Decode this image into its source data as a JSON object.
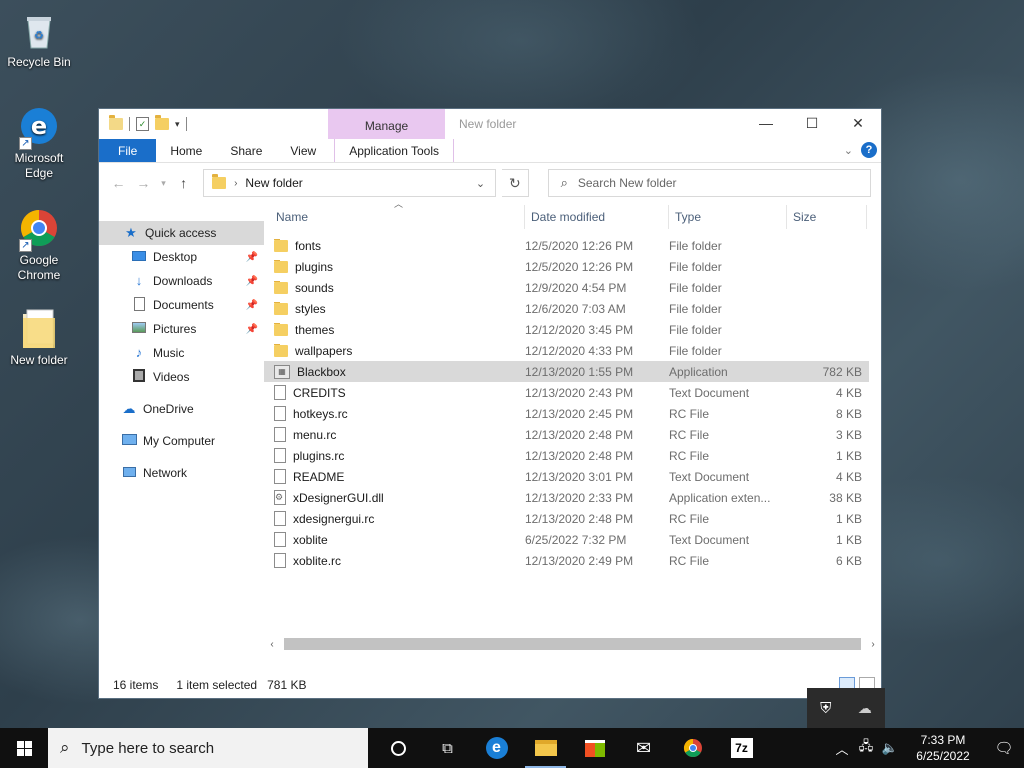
{
  "desktop": {
    "icons": [
      {
        "label": "Recycle Bin",
        "icon": "recycle-bin-icon"
      },
      {
        "label": "Microsoft Edge",
        "icon": "edge-icon"
      },
      {
        "label": "Google Chrome",
        "icon": "chrome-icon"
      },
      {
        "label": "New folder",
        "icon": "folder-icon"
      }
    ]
  },
  "window": {
    "title": "New folder",
    "manage_tab": "Manage",
    "ribbon_tabs": [
      "File",
      "Home",
      "Share",
      "View",
      "Application Tools"
    ],
    "address": "New folder",
    "search_placeholder": "Search New folder",
    "nav_pane": {
      "quick_access": "Quick access",
      "pinned": [
        "Desktop",
        "Downloads",
        "Documents",
        "Pictures"
      ],
      "unpinned": [
        "Music",
        "Videos"
      ],
      "onedrive": "OneDrive",
      "my_computer": "My Computer",
      "network": "Network"
    },
    "columns": [
      "Name",
      "Date modified",
      "Type",
      "Size"
    ],
    "files": [
      {
        "name": "fonts",
        "date": "12/5/2020 12:26 PM",
        "type": "File folder",
        "size": "",
        "kind": "folder"
      },
      {
        "name": "plugins",
        "date": "12/5/2020 12:26 PM",
        "type": "File folder",
        "size": "",
        "kind": "folder"
      },
      {
        "name": "sounds",
        "date": "12/9/2020 4:54 PM",
        "type": "File folder",
        "size": "",
        "kind": "folder"
      },
      {
        "name": "styles",
        "date": "12/6/2020 7:03 AM",
        "type": "File folder",
        "size": "",
        "kind": "folder"
      },
      {
        "name": "themes",
        "date": "12/12/2020 3:45 PM",
        "type": "File folder",
        "size": "",
        "kind": "folder"
      },
      {
        "name": "wallpapers",
        "date": "12/12/2020 4:33 PM",
        "type": "File folder",
        "size": "",
        "kind": "folder"
      },
      {
        "name": "Blackbox",
        "date": "12/13/2020 1:55 PM",
        "type": "Application",
        "size": "782 KB",
        "kind": "app",
        "selected": true
      },
      {
        "name": "CREDITS",
        "date": "12/13/2020 2:43 PM",
        "type": "Text Document",
        "size": "4 KB",
        "kind": "file"
      },
      {
        "name": "hotkeys.rc",
        "date": "12/13/2020 2:45 PM",
        "type": "RC File",
        "size": "8 KB",
        "kind": "file"
      },
      {
        "name": "menu.rc",
        "date": "12/13/2020 2:48 PM",
        "type": "RC File",
        "size": "3 KB",
        "kind": "file"
      },
      {
        "name": "plugins.rc",
        "date": "12/13/2020 2:48 PM",
        "type": "RC File",
        "size": "1 KB",
        "kind": "file"
      },
      {
        "name": "README",
        "date": "12/13/2020 3:01 PM",
        "type": "Text Document",
        "size": "4 KB",
        "kind": "file"
      },
      {
        "name": "xDesignerGUI.dll",
        "date": "12/13/2020 2:33 PM",
        "type": "Application exten...",
        "size": "38 KB",
        "kind": "dll"
      },
      {
        "name": "xdesignergui.rc",
        "date": "12/13/2020 2:48 PM",
        "type": "RC File",
        "size": "1 KB",
        "kind": "file"
      },
      {
        "name": "xoblite",
        "date": "6/25/2022 7:32 PM",
        "type": "Text Document",
        "size": "1 KB",
        "kind": "file"
      },
      {
        "name": "xoblite.rc",
        "date": "12/13/2020 2:49 PM",
        "type": "RC File",
        "size": "6 KB",
        "kind": "file"
      }
    ],
    "status": {
      "item_count": "16 items",
      "selection": "1 item selected",
      "selection_size": "781 KB"
    }
  },
  "taskbar": {
    "search_placeholder": "Type here to search",
    "pinned": [
      "cortana-icon",
      "task-view-icon",
      "edge-icon",
      "file-explorer-icon",
      "store-icon",
      "mail-icon",
      "chrome-icon",
      "7zip-icon"
    ],
    "clock_time": "7:33 PM",
    "clock_date": "6/25/2022"
  },
  "colors": {
    "file_tab": "#1a6ec9",
    "manage_tab": "#e9c8f0",
    "selection": "#d9d9d9",
    "taskbar": "#101010"
  }
}
